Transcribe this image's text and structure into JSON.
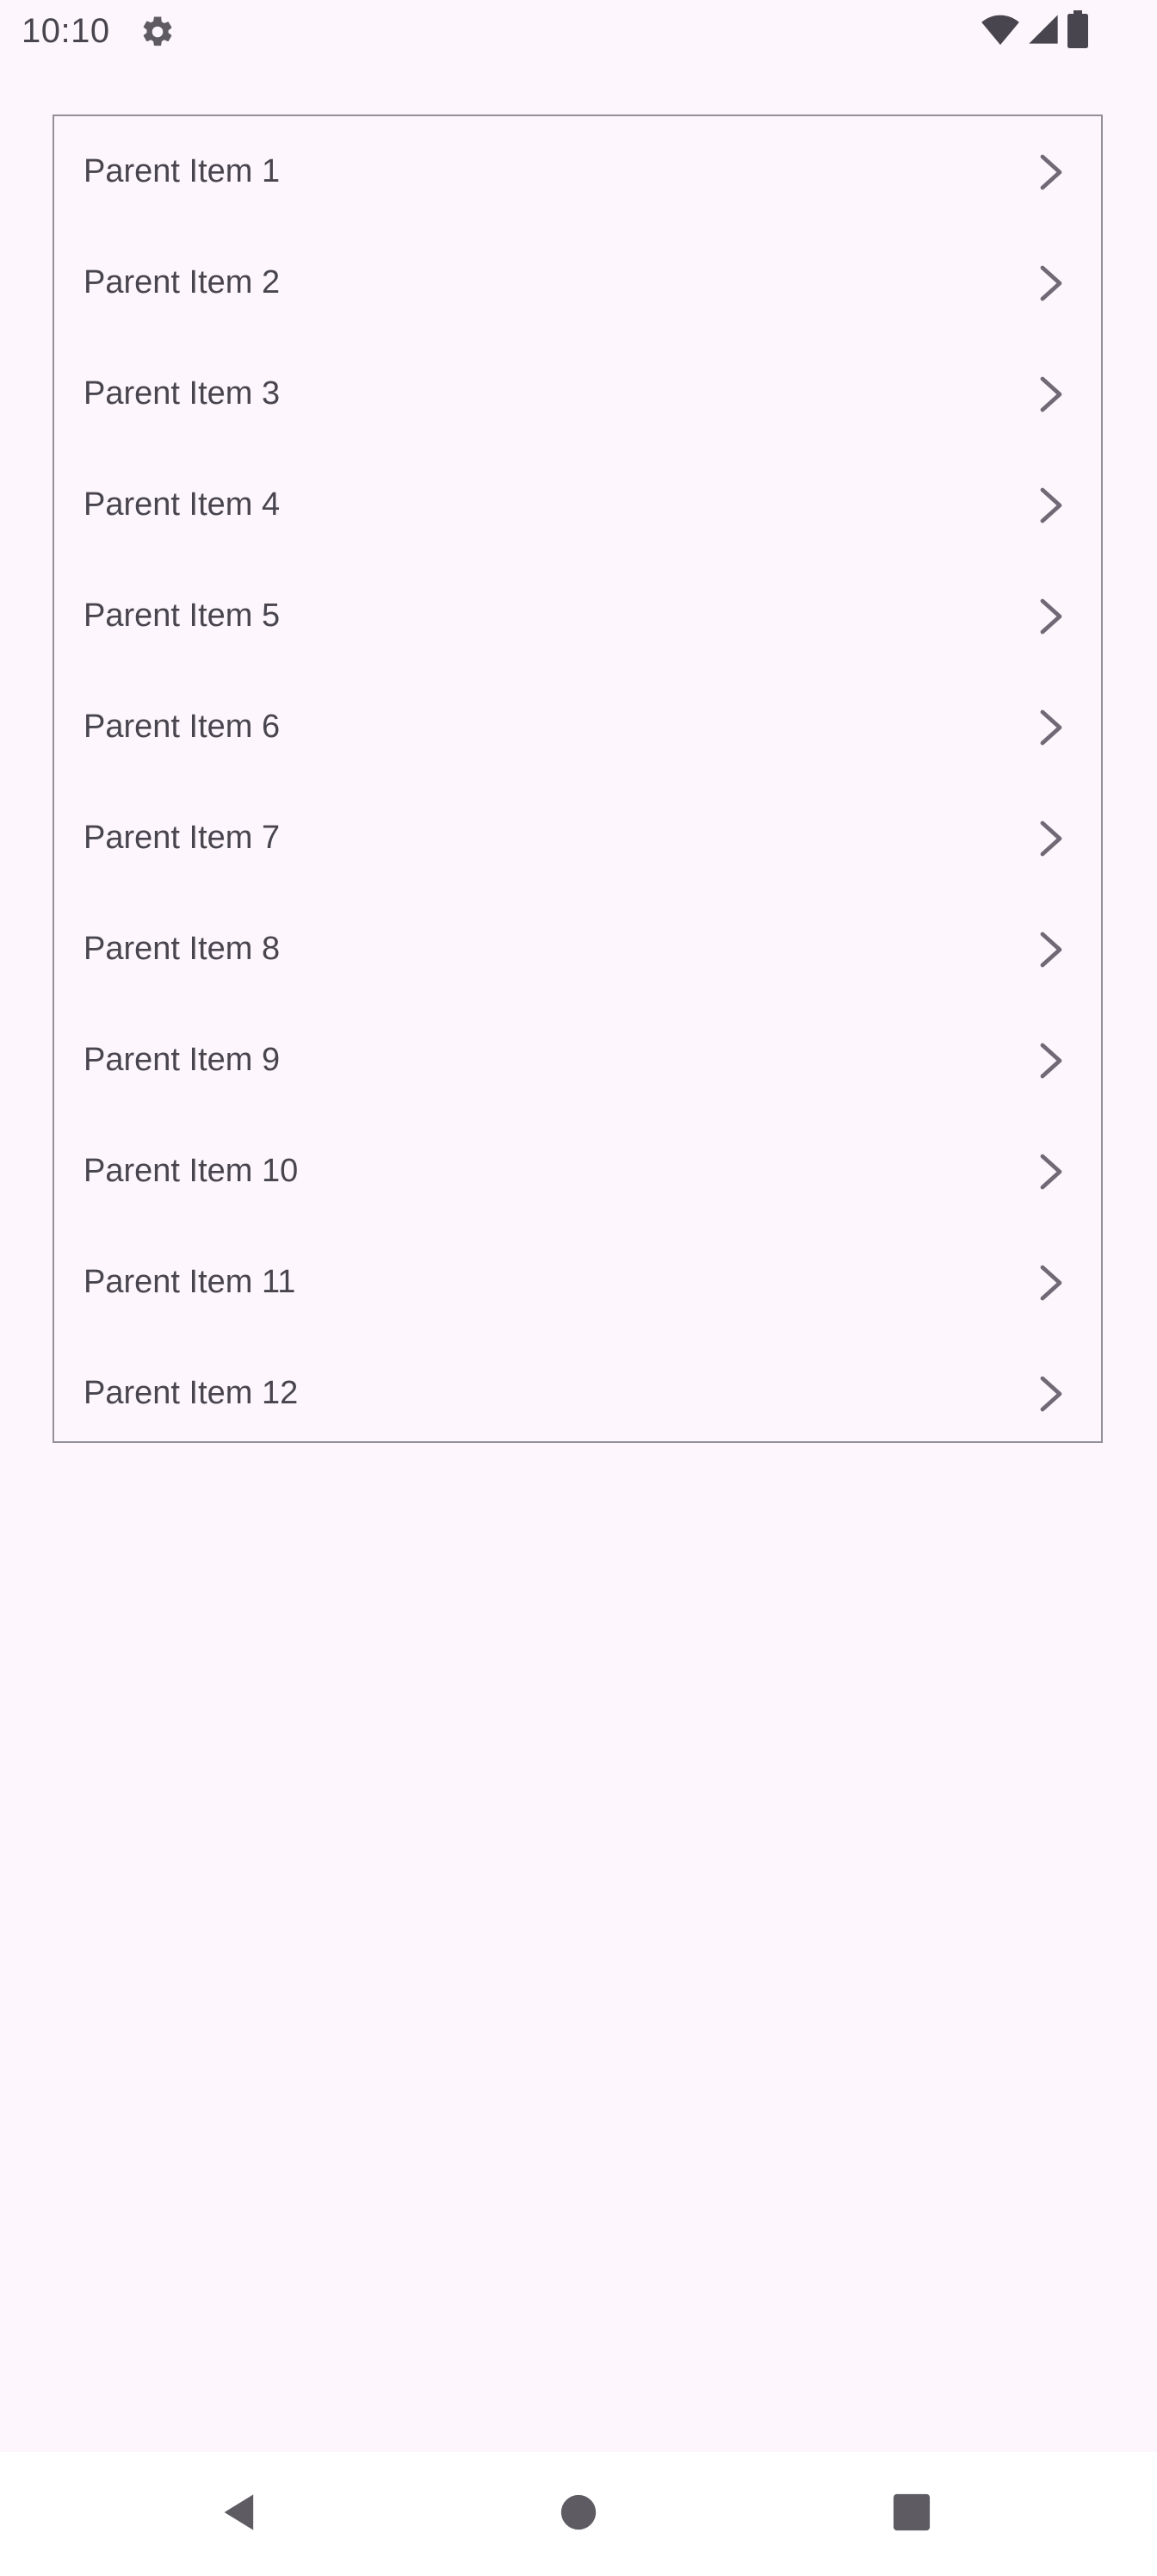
{
  "status_bar": {
    "time": "10:10",
    "icons": [
      "gear-icon",
      "wifi-icon",
      "cellular-signal-icon",
      "battery-icon"
    ]
  },
  "list": {
    "items": [
      {
        "label": "Parent Item 1"
      },
      {
        "label": "Parent Item 2"
      },
      {
        "label": "Parent Item 3"
      },
      {
        "label": "Parent Item 4"
      },
      {
        "label": "Parent Item 5"
      },
      {
        "label": "Parent Item 6"
      },
      {
        "label": "Parent Item 7"
      },
      {
        "label": "Parent Item 8"
      },
      {
        "label": "Parent Item 9"
      },
      {
        "label": "Parent Item 10"
      },
      {
        "label": "Parent Item 11"
      },
      {
        "label": "Parent Item 12"
      }
    ]
  },
  "nav_bar": {
    "buttons": [
      "back-icon",
      "home-icon",
      "recents-icon"
    ]
  },
  "colors": {
    "background": "#fdf7fd",
    "text": "#49454f",
    "outline": "#938f99",
    "icon": "#5f5b63"
  }
}
